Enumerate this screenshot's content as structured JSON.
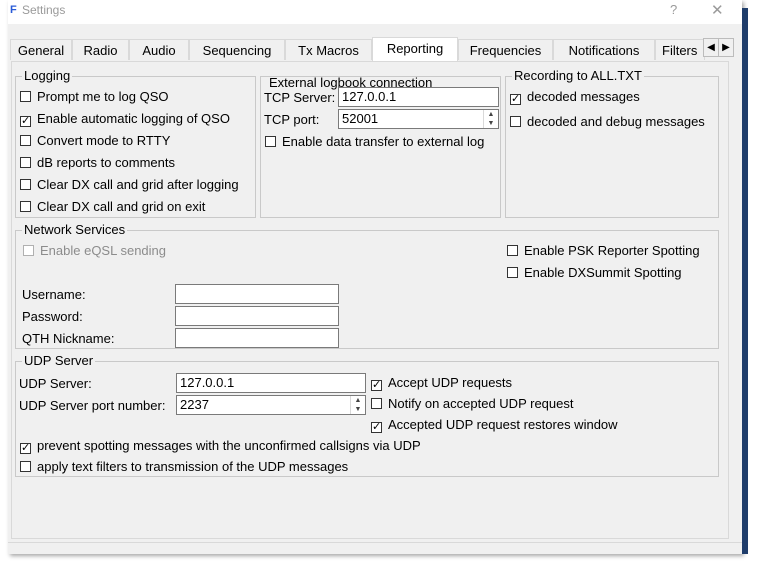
{
  "window": {
    "title": "Settings",
    "help_glyph": "?",
    "close_glyph": "✕",
    "app_glyph": "F"
  },
  "tabs": [
    {
      "label": "General"
    },
    {
      "label": "Radio"
    },
    {
      "label": "Audio"
    },
    {
      "label": "Sequencing"
    },
    {
      "label": "Tx Macros"
    },
    {
      "label": "Reporting"
    },
    {
      "label": "Frequencies"
    },
    {
      "label": "Notifications"
    },
    {
      "label": "Filters"
    }
  ],
  "active_tab": "Reporting",
  "tab_scroll": {
    "left": "◀",
    "right": "▶"
  },
  "logging": {
    "title": "Logging",
    "items": [
      {
        "label": "Prompt me to log QSO",
        "checked": false
      },
      {
        "label": "Enable automatic logging of QSO",
        "checked": true
      },
      {
        "label": "Convert mode to RTTY",
        "checked": false
      },
      {
        "label": "dB reports to comments",
        "checked": false
      },
      {
        "label": "Clear DX call and grid after logging",
        "checked": false
      },
      {
        "label": "Clear DX call and grid on exit",
        "checked": false
      }
    ]
  },
  "external": {
    "title": "External logbook connection",
    "tcp_server_label": "TCP Server:",
    "tcp_server_value": "127.0.0.1",
    "tcp_port_label": "TCP port:",
    "tcp_port_value": "52001",
    "enable_transfer_label": "Enable data transfer to external log",
    "enable_transfer_checked": false
  },
  "recording": {
    "title": "Recording to ALL.TXT",
    "items": [
      {
        "label": "decoded messages",
        "checked": true
      },
      {
        "label": "decoded and debug messages",
        "checked": false
      }
    ]
  },
  "network": {
    "title": "Network Services",
    "eqsl_label": "Enable eQSL sending",
    "eqsl_checked": false,
    "psk_label": "Enable PSK Reporter Spotting",
    "psk_checked": false,
    "dxsummit_label": "Enable DXSummit Spotting",
    "dxsummit_checked": false,
    "username_label": "Username:",
    "username_value": "",
    "password_label": "Password:",
    "password_value": "",
    "qth_label": "QTH Nickname:",
    "qth_value": ""
  },
  "udp": {
    "title": "UDP Server",
    "server_label": "UDP Server:",
    "server_value": "127.0.0.1",
    "port_label": "UDP Server port number:",
    "port_value": "2237",
    "accept_label": "Accept UDP requests",
    "accept_checked": true,
    "notify_label": "Notify on accepted UDP request",
    "notify_checked": false,
    "restore_label": "Accepted UDP request restores window",
    "restore_checked": true,
    "prevent_label": "prevent spotting messages with the unconfirmed callsigns via UDP",
    "prevent_checked": true,
    "filters_label": "apply text filters to transmission of the UDP messages",
    "filters_checked": false
  },
  "check_glyph": "✓"
}
